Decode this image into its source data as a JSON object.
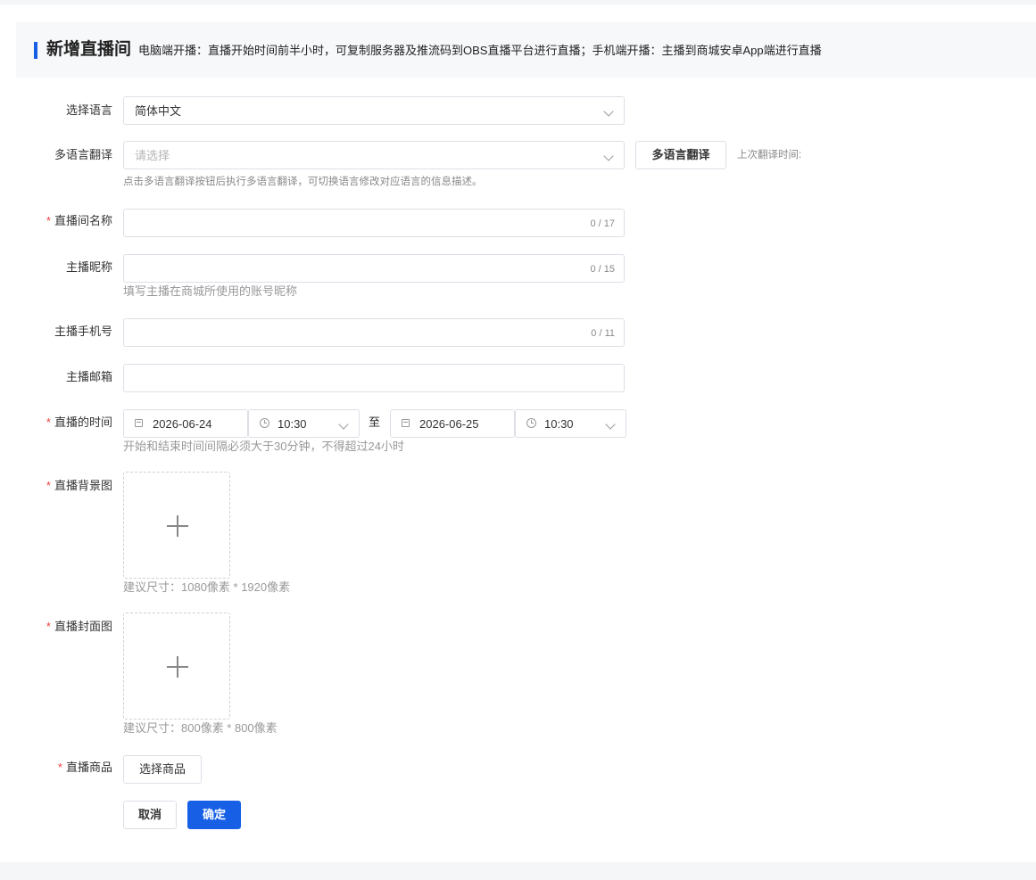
{
  "header": {
    "title": "新增直播间",
    "description": "电脑端开播：直播开始时间前半小时，可复制服务器及推流码到OBS直播平台进行直播；手机端开播：主播到商城安卓App端进行直播"
  },
  "language": {
    "label": "选择语言",
    "value": "简体中文"
  },
  "translation": {
    "label": "多语言翻译",
    "placeholder": "请选择",
    "button": "多语言翻译",
    "last_time_label": "上次翻译时间:",
    "help": "点击多语言翻译按钮后执行多语言翻译，可切换语言修改对应语言的信息描述。"
  },
  "room_name": {
    "label": "直播间名称",
    "required_mark": "*",
    "count": "0 / 17"
  },
  "host_nickname": {
    "label": "主播昵称",
    "count": "0 / 15",
    "help": "填写主播在商城所使用的账号昵称"
  },
  "host_phone": {
    "label": "主播手机号",
    "count": "0 / 11"
  },
  "host_email": {
    "label": "主播邮箱"
  },
  "live_time": {
    "label": "直播的时间",
    "required_mark": "*",
    "start_date": "2026-06-24",
    "start_time": "10:30",
    "separator": "至",
    "end_date": "2026-06-25",
    "end_time": "10:30",
    "help": "开始和结束时间间隔必须大于30分钟，不得超过24小时"
  },
  "background_image": {
    "label": "直播背景图",
    "required_mark": "*",
    "help": "建议尺寸：1080像素 * 1920像素"
  },
  "cover_image": {
    "label": "直播封面图",
    "required_mark": "*",
    "help": "建议尺寸：800像素 * 800像素"
  },
  "products": {
    "label": "直播商品",
    "required_mark": "*",
    "button": "选择商品"
  },
  "actions": {
    "cancel": "取消",
    "confirm": "确定"
  },
  "colors": {
    "primary": "#1760e6",
    "required": "#f04141"
  },
  "icons": {
    "select": "chevron-down-icon",
    "date": "calendar-icon",
    "time": "clock-icon",
    "upload": "plus-icon"
  }
}
